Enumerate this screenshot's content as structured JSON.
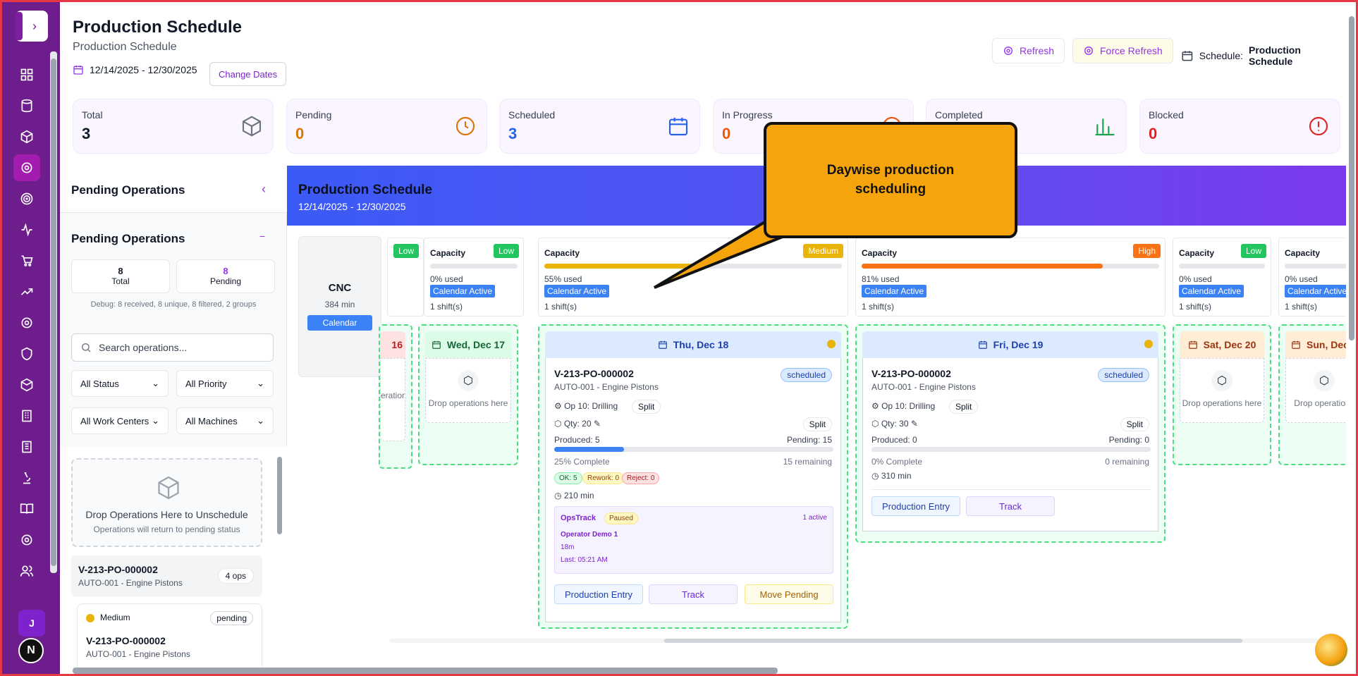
{
  "header": {
    "title": "Production Schedule",
    "subtitle": "Production Schedule",
    "date_range": "12/14/2025 - 12/30/2025",
    "change_dates": "Change Dates",
    "refresh": "Refresh",
    "force_refresh": "Force Refresh",
    "schedule_prefix": "Schedule:",
    "schedule_name": "Production Schedule"
  },
  "stats": [
    {
      "label": "Total",
      "value": "3",
      "color": "#111827"
    },
    {
      "label": "Pending",
      "value": "0",
      "color": "#d97706"
    },
    {
      "label": "Scheduled",
      "value": "3",
      "color": "#2563eb"
    },
    {
      "label": "In Progress",
      "value": "0",
      "color": "#ea580c"
    },
    {
      "label": "Completed",
      "value": "",
      "color": "#16a34a"
    },
    {
      "label": "Blocked",
      "value": "0",
      "color": "#dc2626"
    }
  ],
  "left": {
    "panel_title": "Pending Operations",
    "section_title": "Pending Operations",
    "total_n": "8",
    "total_lbl": "Total",
    "pending_n": "8",
    "pending_lbl": "Pending",
    "debug": "Debug: 8 received, 8 unique, 8 filtered, 2 groups",
    "search_placeholder": "Search operations...",
    "status": "All Status",
    "priority": "All Priority",
    "workcenters": "All Work Centers",
    "machines": "All Machines",
    "drop_title": "Drop Operations Here to Unschedule",
    "drop_sub": "Operations will return to pending status",
    "group_id": "V-213-PO-000002",
    "group_part": "AUTO-001 - Engine Pistons",
    "group_ops": "4 ops",
    "card_priority": "Medium",
    "card_status": "pending",
    "card_id": "V-213-PO-000002",
    "card_part": "AUTO-001 - Engine Pistons"
  },
  "schedule": {
    "title": "Production Schedule",
    "dates": "12/14/2025 - 12/30/2025",
    "machine": "CNC",
    "minutes": "384 min",
    "calendar": "Calendar"
  },
  "capacity": [
    {
      "title": "",
      "badge": "Low",
      "badge_color": "#22c55e",
      "used": "",
      "pct": 0
    },
    {
      "title": "Capacity",
      "badge": "Low",
      "badge_color": "#22c55e",
      "used": "0% used",
      "active": "Calendar Active",
      "shifts": "1 shift(s)",
      "pct": 0
    },
    {
      "title": "Capacity",
      "badge": "Medium",
      "badge_color": "#eab308",
      "used": "55% used",
      "active": "Calendar Active",
      "shifts": "1 shift(s)",
      "pct": 55
    },
    {
      "title": "Capacity",
      "badge": "High",
      "badge_color": "#f97316",
      "used": "81% used",
      "active": "Calendar Active",
      "shifts": "1 shift(s)",
      "pct": 81
    },
    {
      "title": "Capacity",
      "badge": "Low",
      "badge_color": "#22c55e",
      "used": "0% used",
      "active": "Calendar Active",
      "shifts": "1 shift(s)",
      "pct": 0
    },
    {
      "title": "Capacity",
      "badge": "",
      "badge_color": "#22c55e",
      "used": "0% used",
      "active": "Calendar Active",
      "shifts": "1 shift(s)",
      "pct": 0
    }
  ],
  "days": {
    "d16": {
      "label": "16",
      "empty": "erations"
    },
    "d17": {
      "label": "Wed, Dec 17",
      "empty": "Drop operations here"
    },
    "d18": {
      "label": "Thu, Dec 18"
    },
    "d19": {
      "label": "Fri, Dec 19"
    },
    "d20": {
      "label": "Sat, Dec 20",
      "empty": "Drop operations here"
    },
    "d21": {
      "label": "Sun, Dec",
      "empty": "Drop operations"
    }
  },
  "job18": {
    "id": "V-213-PO-000002",
    "part": "AUTO-001 - Engine Pistons",
    "status": "scheduled",
    "op": "Op 10: Drilling",
    "split": "Split",
    "qty": "Qty:  20",
    "produced": "Produced: 5",
    "pending": "Pending: 15",
    "progress": 25,
    "complete": "25% Complete",
    "remaining": "15 remaining",
    "ok": "OK: 5",
    "rework": "Rework: 0",
    "reject": "Reject: 0",
    "time": "210 min",
    "opstrack": "OpsTrack",
    "paused": "Paused",
    "active": "1 active",
    "operator": "Operator Demo 1",
    "elapsed": "18m",
    "last": "Last: 05:21 AM",
    "entry": "Production Entry",
    "track": "Track",
    "move": "Move Pending"
  },
  "job19": {
    "id": "V-213-PO-000002",
    "part": "AUTO-001 - Engine Pistons",
    "status": "scheduled",
    "op": "Op 10: Drilling",
    "split": "Split",
    "qty": "Qty:  30",
    "produced": "Produced: 0",
    "pending": "Pending: 0",
    "progress": 0,
    "complete": "0% Complete",
    "remaining": "0 remaining",
    "time": "310 min",
    "entry": "Production Entry",
    "track": "Track"
  },
  "callout": {
    "text": "Daywise production scheduling"
  },
  "rail": {
    "avatar": "J",
    "badge": "N"
  }
}
